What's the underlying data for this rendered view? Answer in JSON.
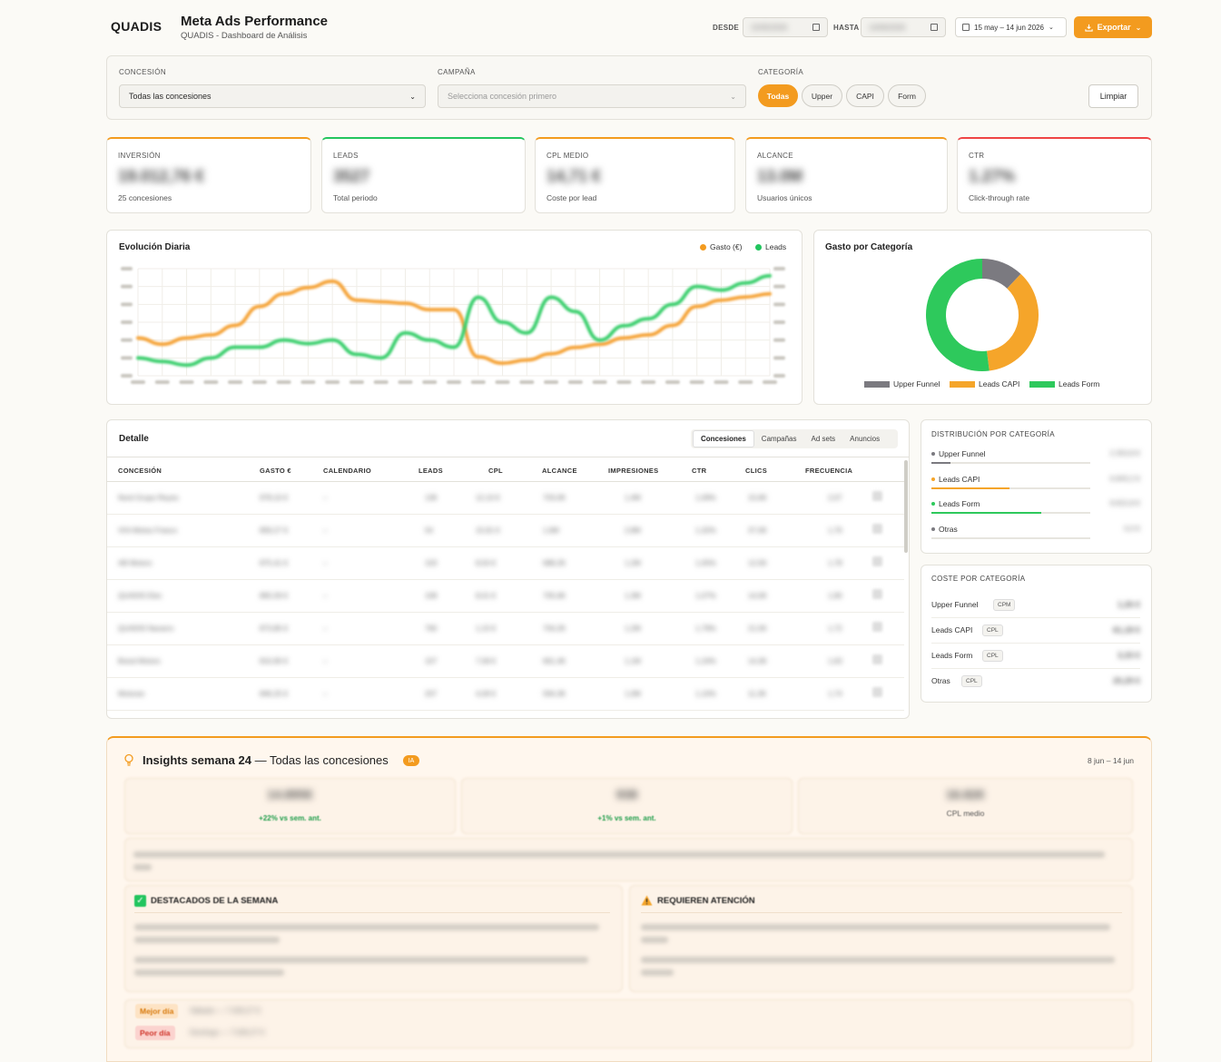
{
  "header": {
    "logo": "QUADIS",
    "title": "Meta Ads Performance",
    "subtitle": "QUADIS - Dashboard de Análisis",
    "from_label": "DESDE",
    "from_value": "15/05/2026",
    "to_label": "HASTA",
    "to_value": "14/06/2026",
    "range_label": "15 may – 14 jun 2026",
    "export_label": "Exportar"
  },
  "filters": {
    "concesion_label": "CONCESIÓN",
    "concesion_value": "Todas las concesiones",
    "campana_label": "CAMPAÑA",
    "campana_placeholder": "Selecciona concesión primero",
    "categoria_label": "CATEGORÍA",
    "chips": [
      "Todas",
      "Upper",
      "CAPI",
      "Form"
    ],
    "active_chip": "Todas",
    "clear_label": "Limpiar"
  },
  "kpis": [
    {
      "label": "INVERSIÓN",
      "value": "19.012,76 €",
      "sub": "25 concesiones",
      "color": "#f39b1f"
    },
    {
      "label": "LEADS",
      "value": "3527",
      "sub": "Total periodo",
      "color": "#22c55e"
    },
    {
      "label": "CPL MEDIO",
      "value": "14,71 €",
      "sub": "Coste por lead",
      "color": "#f39b1f"
    },
    {
      "label": "ALCANCE",
      "value": "13.0M",
      "sub": "Usuarios únicos",
      "color": "#f39b1f"
    },
    {
      "label": "CTR",
      "value": "1.27%",
      "sub": "Click-through rate",
      "color": "#ef4444"
    }
  ],
  "daily_chart": {
    "title": "Evolución Diaria",
    "legend": [
      "Gasto (€)",
      "Leads"
    ]
  },
  "chart_data": [
    {
      "type": "line",
      "series": [
        {
          "name": "Gasto (€)",
          "color": "#f5a43a",
          "values": [
            380,
            360,
            380,
            390,
            420,
            480,
            520,
            540,
            560,
            500,
            495,
            490,
            470,
            470,
            320,
            300,
            310,
            330,
            350,
            360,
            380,
            390,
            420,
            480,
            500,
            510,
            520
          ]
        },
        {
          "name": "Leads",
          "color": "#3ccf6e",
          "values": [
            45,
            40,
            35,
            45,
            60,
            60,
            70,
            65,
            70,
            50,
            45,
            80,
            70,
            60,
            130,
            95,
            80,
            130,
            110,
            70,
            90,
            100,
            120,
            145,
            140,
            150,
            160
          ]
        }
      ]
    },
    {
      "type": "pie",
      "title": "Gasto por Categoría",
      "categories": [
        "Upper Funnel",
        "Leads CAPI",
        "Leads Form"
      ],
      "values": [
        12,
        36,
        52
      ],
      "colors": [
        "#7b7a80",
        "#f5a52a",
        "#2ec95c"
      ]
    }
  ],
  "donut": {
    "title": "Gasto por Categoría",
    "legend": [
      "Upper Funnel",
      "Leads CAPI",
      "Leads Form"
    ]
  },
  "table": {
    "title": "Detalle",
    "tabs": [
      "Concesiones",
      "Campañas",
      "Ad sets",
      "Anuncios"
    ],
    "active_tab": "Concesiones",
    "columns": [
      "CONCESIÓN",
      "GASTO €",
      "CALENDARIO",
      "LEADS",
      "CPL",
      "ALCANCE",
      "IMPRESIONES",
      "CTR",
      "CLICS",
      "FRECUENCIA"
    ],
    "rows": [
      [
        "Nord Grupo Reyes",
        "978,10 €",
        "–",
        "136",
        "12,10 €",
        "703,0K",
        "1,4M",
        "1,09%",
        "15,6K",
        "2,07"
      ],
      [
        "ViVi-Motos Frasco",
        "859,27 €",
        "–",
        "54",
        "15,91 €",
        "1,6M",
        "2,8M",
        "1,32%",
        "37,0K",
        "1,76"
      ],
      [
        "AB Motors",
        "875,41 €",
        "–",
        "103",
        "8,50 €",
        "688,2K",
        "1,2M",
        "1,05%",
        "12,5K",
        "1,78"
      ],
      [
        "QUADIS Elec",
        "865,59 €",
        "–",
        "108",
        "8,01 €",
        "705,6K",
        "1,3M",
        "1,07%",
        "14,0K",
        "1,90"
      ],
      [
        "QUADIS Navarro",
        "873,85 €",
        "–",
        "760",
        "1,15 €",
        "704,2K",
        "1,2M",
        "1,79%",
        "21,5K",
        "1,72"
      ],
      [
        "Boixd Motors",
        "810,90 €",
        "–",
        "107",
        "7,58 €",
        "661,4K",
        "1,1M",
        "1,24%",
        "14,3K",
        "1,63"
      ],
      [
        "Motoran",
        "846,25 €",
        "–",
        "207",
        "4,09 €",
        "594,3K",
        "1,0M",
        "1,10%",
        "11,3K",
        "1,74"
      ]
    ]
  },
  "distribution": {
    "title": "DISTRIBUCIÓN POR CATEGORÍA",
    "items": [
      {
        "name": "Upper Funnel",
        "value": "2.353,8 €",
        "color": "#7b7a80",
        "share": 0.12
      },
      {
        "name": "Leads CAPI",
        "value": "6.843,2 €",
        "color": "#f5a52a",
        "share": 0.49
      },
      {
        "name": "Leads Form",
        "value": "9.815,8 €",
        "color": "#2ec95c",
        "share": 0.69
      },
      {
        "name": "Otras",
        "value": "0,0 €",
        "color": "#7b7a80",
        "share": 0.0
      }
    ]
  },
  "cost": {
    "title": "COSTE POR CATEGORÍA",
    "items": [
      {
        "name": "Upper Funnel",
        "tag": "CPM",
        "value": "1,26 €"
      },
      {
        "name": "Leads CAPI",
        "tag": "CPL",
        "value": "61,18 €"
      },
      {
        "name": "Leads Form",
        "tag": "CPL",
        "value": "3,33 €"
      },
      {
        "name": "Otras",
        "tag": "CPL",
        "value": "20,29 €"
      }
    ]
  },
  "insights": {
    "title_bold": "Insights semana 24",
    "title_rest": "— Todas las concesiones",
    "badge": "IA",
    "range": "8 jun – 14 jun",
    "stats": [
      {
        "value": "14.895€",
        "delta": "+22% vs sem. ant."
      },
      {
        "value": "938",
        "delta": "+1% vs sem. ant."
      },
      {
        "value": "16.82€",
        "sub": "CPL medio"
      }
    ],
    "highlights_title": "DESTACADOS DE LA SEMANA",
    "attention_title": "REQUIEREN ATENCIÓN",
    "best_day_label": "Mejor día",
    "best_day_value": "Sábado — 7.026,27 €",
    "worst_day_label": "Peor día",
    "worst_day_value": "Domingo — 7.026,27 €"
  }
}
